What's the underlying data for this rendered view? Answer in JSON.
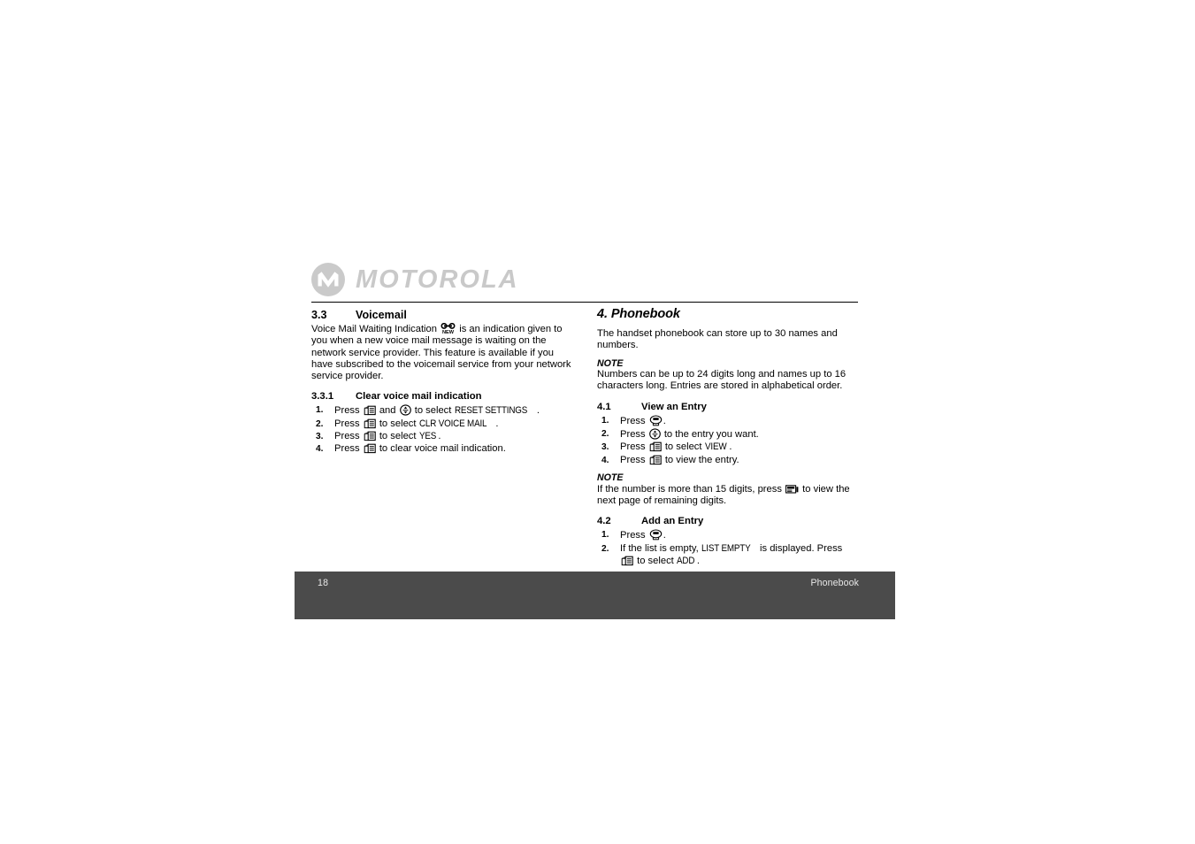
{
  "logo": {
    "wordmark": "MOTOROLA",
    "emblem_name": "motorola-batwing-emblem",
    "color": "#c9c9c9"
  },
  "left_column": {
    "section": {
      "number": "3.3",
      "title": "Voicemail"
    },
    "intro_part1": "Voice Mail Waiting Indication",
    "intro_part2": "is an indication given to you when a new voice mail message is waiting on the network service provider.  This feature is available if you have subscribed to the voicemail service from your network service provider.",
    "subsection": {
      "number": "3.3.1",
      "title": "Clear voice mail indication"
    },
    "steps": [
      {
        "num": "1.",
        "pre": "Press",
        "icon1": "softkey-icon",
        "mid": "and",
        "icon2": "navkey-icon",
        "post": "to select",
        "lcd": "RESET SETTINGS",
        "end": "."
      },
      {
        "num": "2.",
        "pre": "Press",
        "icon1": "softkey-icon",
        "post": "to select",
        "lcd": "CLR VOICE MAIL",
        "end": "."
      },
      {
        "num": "3.",
        "pre": "Press",
        "icon1": "softkey-icon",
        "post": "to select",
        "lcd": "YES",
        "end": "."
      },
      {
        "num": "4.",
        "pre": "Press",
        "icon1": "softkey-icon",
        "post": "to clear voice mail indication.",
        "lcd": "",
        "end": ""
      }
    ]
  },
  "right_column": {
    "chapter_title": "4. Phonebook",
    "intro": "The handset phonebook can store up to 30 names and numbers.",
    "note1_label": "NOTE",
    "note1_body": "Numbers can be up to 24 digits long and names up to 16 characters long. Entries are stored in alphabetical order.",
    "section41": {
      "number": "4.1",
      "title": "View an Entry"
    },
    "steps41": [
      {
        "num": "1.",
        "pre": "Press",
        "icon1": "okkey-icon",
        "post": ".",
        "lcd": "",
        "end": ""
      },
      {
        "num": "2.",
        "pre": "Press",
        "icon1": "navkey-icon",
        "post": "to the entry you want.",
        "lcd": "",
        "end": ""
      },
      {
        "num": "3.",
        "pre": "Press",
        "icon1": "softkey-icon",
        "post": "to select",
        "lcd": "VIEW",
        "end": "."
      },
      {
        "num": "4.",
        "pre": "Press",
        "icon1": "softkey-icon",
        "post": "to view the entry.",
        "lcd": "",
        "end": ""
      }
    ],
    "note2_label": "NOTE",
    "note2_pre": "If the number is more than 15 digits, press",
    "note2_icon": "page-next-icon",
    "note2_post": "to view the next page of remaining digits.",
    "section42": {
      "number": "4.2",
      "title": "Add an Entry"
    },
    "steps42_1": {
      "num": "1.",
      "pre": "Press",
      "icon1": "okkey-icon",
      "post": ".",
      "lcd": "",
      "end": ""
    },
    "steps42_2": {
      "num": "2.",
      "pre": "If the list is empty,",
      "lcd1": "LIST EMPTY",
      "mid": "is displayed. Press",
      "icon1": "softkey-icon",
      "post": "to select",
      "lcd2": "ADD",
      "end": "."
    }
  },
  "footer": {
    "page_number": "18",
    "title": "Phonebook",
    "background": "#4b4b4b",
    "text_color": "#e8e8e8"
  }
}
